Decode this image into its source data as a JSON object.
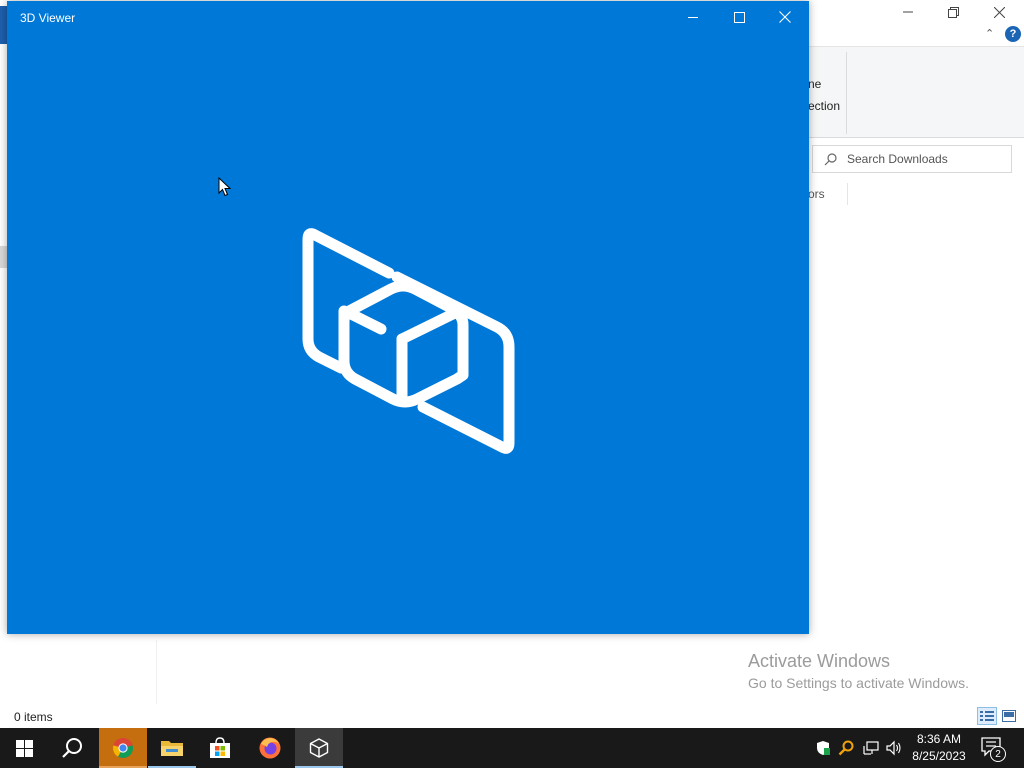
{
  "explorer": {
    "ribbon_fragment_1": "ne",
    "ribbon_fragment_2": "ection",
    "search_placeholder": "Search Downloads",
    "column_fragment": "ors",
    "status": "0 items"
  },
  "viewer": {
    "title": "3D Viewer",
    "background_color": "#0078d7"
  },
  "watermark": {
    "line1": "Activate Windows",
    "line2": "Go to Settings to activate Windows."
  },
  "taskbar": {
    "apps": [
      {
        "name": "Start",
        "icon": "windows-logo-icon"
      },
      {
        "name": "Search",
        "icon": "search-icon"
      },
      {
        "name": "Google Chrome",
        "icon": "chrome-icon"
      },
      {
        "name": "File Explorer",
        "icon": "folder-icon"
      },
      {
        "name": "Microsoft Store",
        "icon": "store-icon"
      },
      {
        "name": "Firefox",
        "icon": "firefox-icon"
      },
      {
        "name": "3D Viewer",
        "icon": "cube-icon"
      }
    ],
    "clock_time": "8:36 AM",
    "clock_date": "8/25/2023",
    "notification_count": "2"
  }
}
